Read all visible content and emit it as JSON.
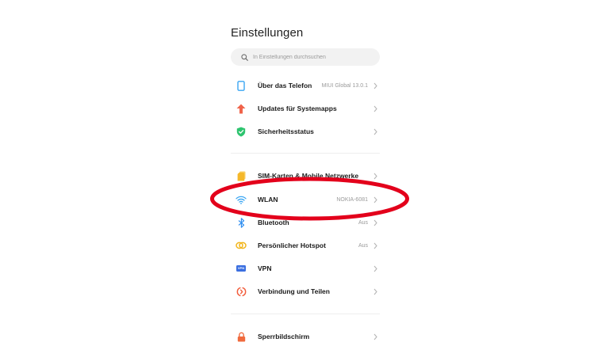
{
  "page": {
    "title": "Einstellungen"
  },
  "search": {
    "placeholder": "In Einstellungen durchsuchen"
  },
  "groups": [
    {
      "items": [
        {
          "label": "Über das Telefon",
          "value": "MIUI Global 13.0.1",
          "icon": "phone-icon"
        },
        {
          "label": "Updates für Systemapps",
          "value": "",
          "icon": "arrow-up-icon"
        },
        {
          "label": "Sicherheitsstatus",
          "value": "",
          "icon": "shield-check-icon"
        }
      ]
    },
    {
      "items": [
        {
          "label": "SIM-Karten & Mobile Netzwerke",
          "value": "",
          "icon": "sim-card-icon"
        },
        {
          "label": "WLAN",
          "value": "NOKIA-6081",
          "icon": "wifi-icon"
        },
        {
          "label": "Bluetooth",
          "value": "Aus",
          "icon": "bluetooth-icon"
        },
        {
          "label": "Persönlicher Hotspot",
          "value": "Aus",
          "icon": "hotspot-icon"
        },
        {
          "label": "VPN",
          "value": "",
          "icon": "vpn-icon",
          "icon_text": "VPN"
        },
        {
          "label": "Verbindung und Teilen",
          "value": "",
          "icon": "connection-share-icon"
        }
      ]
    },
    {
      "items": [
        {
          "label": "Sperrbildschirm",
          "value": "",
          "icon": "lock-icon"
        }
      ]
    }
  ],
  "colors": {
    "accent_blue": "#3aa6f3",
    "update_orange": "#f0634a",
    "shield_green": "#2ec46f",
    "sim_yellow": "#f5b82a",
    "hotspot_yellow": "#f2b61e",
    "vpn_blue": "#3b6fe0",
    "share_orange": "#f25d3c",
    "lock_orange": "#f06a3d",
    "highlight_red": "#e3001b"
  }
}
